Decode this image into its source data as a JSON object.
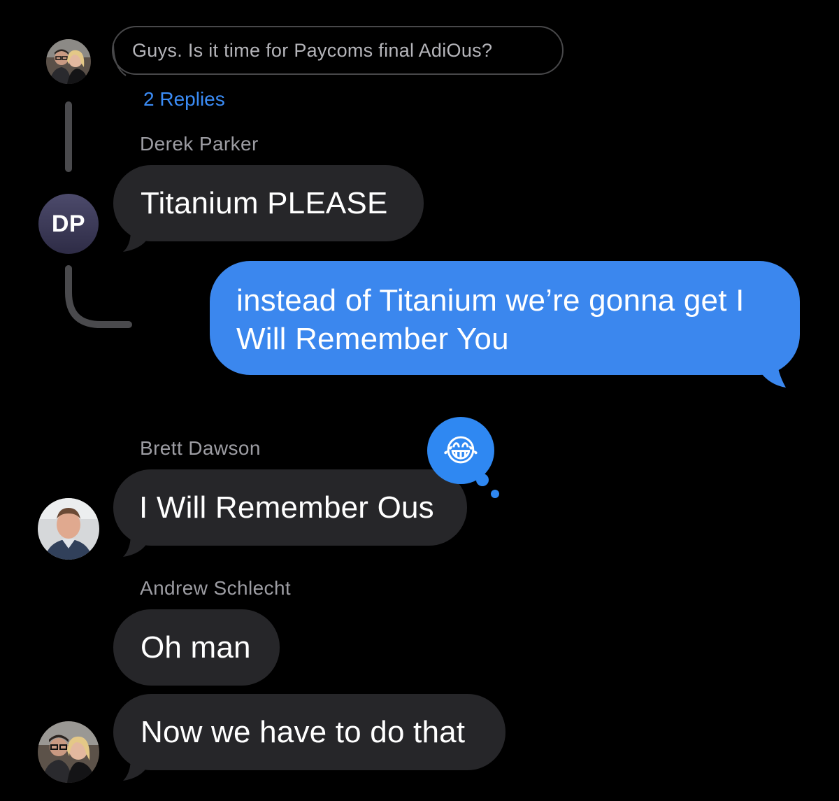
{
  "thread": {
    "origin_message": "Guys. Is it time for Paycoms final AdiOus?",
    "replies_link": "2 Replies"
  },
  "messages": [
    {
      "sender": "Derek Parker",
      "avatar_initials": "DP",
      "text": "Titanium PLEASE",
      "direction": "incoming"
    },
    {
      "sender": "",
      "text": "instead of Titanium we’re gonna get I Will Remember You",
      "direction": "outgoing"
    },
    {
      "sender": "Brett Dawson",
      "text": "I Will Remember Ous",
      "direction": "incoming",
      "tapback": "😂"
    },
    {
      "sender": "Andrew Schlecht",
      "text": "Oh man",
      "direction": "incoming"
    },
    {
      "sender": "",
      "text": "Now we have to do that",
      "direction": "incoming"
    }
  ],
  "colors": {
    "background": "#000000",
    "incoming_bubble": "#262629",
    "outgoing_bubble": "#3b87ee",
    "link": "#3b8cf6",
    "sender_name": "#9d9da3",
    "tapback": "#2f88f2"
  }
}
